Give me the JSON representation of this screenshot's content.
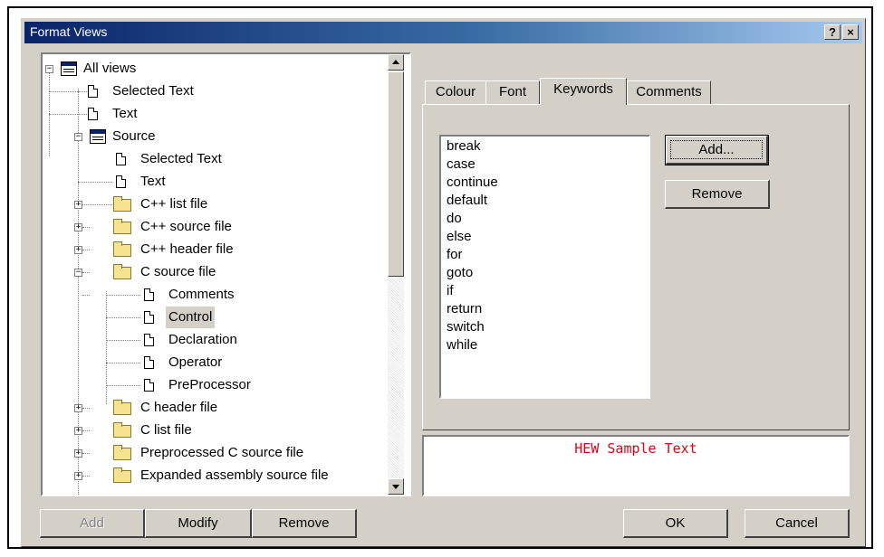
{
  "window": {
    "title": "Format Views",
    "help_label": "?",
    "close_label": "×"
  },
  "tree": {
    "items": [
      {
        "label": "All views",
        "icon": "views-icon"
      },
      {
        "label": "Selected Text",
        "icon": "document-icon"
      },
      {
        "label": "Text",
        "icon": "document-icon"
      },
      {
        "label": "Source",
        "icon": "views-icon"
      },
      {
        "label": "Selected Text",
        "icon": "document-icon"
      },
      {
        "label": "Text",
        "icon": "document-icon"
      },
      {
        "label": "C++ list file",
        "icon": "folder-icon"
      },
      {
        "label": "C++ source file",
        "icon": "folder-icon"
      },
      {
        "label": "C++ header file",
        "icon": "folder-icon"
      },
      {
        "label": "C source file",
        "icon": "folder-icon"
      },
      {
        "label": "Comments",
        "icon": "document-icon"
      },
      {
        "label": "Control",
        "icon": "document-icon",
        "selected": true
      },
      {
        "label": "Declaration",
        "icon": "document-icon"
      },
      {
        "label": "Operator",
        "icon": "document-icon"
      },
      {
        "label": "PreProcessor",
        "icon": "document-icon"
      },
      {
        "label": "C header file",
        "icon": "folder-icon"
      },
      {
        "label": "C list file",
        "icon": "folder-icon"
      },
      {
        "label": "Preprocessed C source file",
        "icon": "folder-icon"
      },
      {
        "label": "Expanded assembly source file",
        "icon": "folder-icon"
      }
    ]
  },
  "tabs": [
    {
      "label": "Colour"
    },
    {
      "label": "Font"
    },
    {
      "label": "Keywords",
      "active": true
    },
    {
      "label": "Comments"
    }
  ],
  "keywords": {
    "items": [
      "break",
      "case",
      "continue",
      "default",
      "do",
      "else",
      "for",
      "goto",
      "if",
      "return",
      "switch",
      "while"
    ],
    "add_label": "Add...",
    "remove_label": "Remove"
  },
  "sample": {
    "text": "HEW Sample Text",
    "color": "#e0001a"
  },
  "buttons": {
    "add_label": "Add",
    "modify_label": "Modify",
    "remove_label": "Remove",
    "ok_label": "OK",
    "cancel_label": "Cancel"
  },
  "colors": {
    "title_start": "#0a246a",
    "title_end": "#a6caf0",
    "face": "#d4d0c8"
  }
}
